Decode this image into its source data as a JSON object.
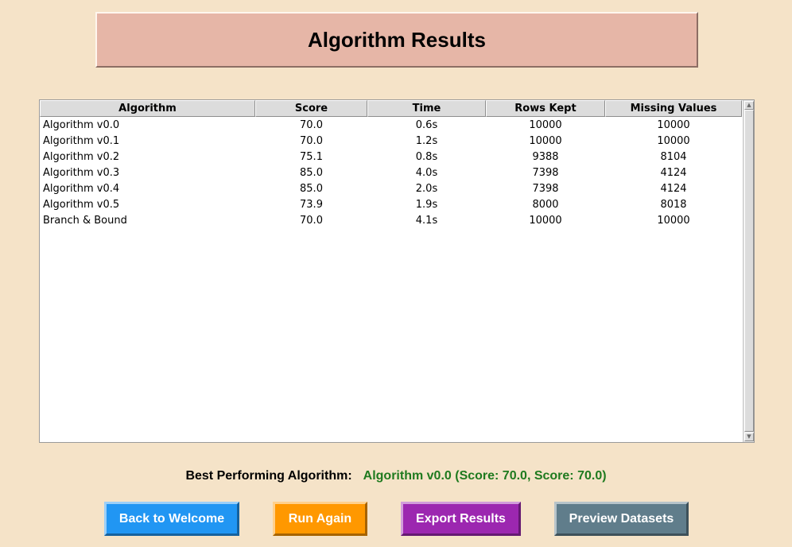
{
  "header": {
    "title": "Algorithm Results"
  },
  "table": {
    "columns": [
      "Algorithm",
      "Score",
      "Time",
      "Rows Kept",
      "Missing Values"
    ],
    "rows": [
      [
        "Algorithm v0.0",
        "70.0",
        "0.6s",
        "10000",
        "10000"
      ],
      [
        "Algorithm v0.1",
        "70.0",
        "1.2s",
        "10000",
        "10000"
      ],
      [
        "Algorithm v0.2",
        "75.1",
        "0.8s",
        "9388",
        "8104"
      ],
      [
        "Algorithm v0.3",
        "85.0",
        "4.0s",
        "7398",
        "4124"
      ],
      [
        "Algorithm v0.4",
        "85.0",
        "2.0s",
        "7398",
        "4124"
      ],
      [
        "Algorithm v0.5",
        "73.9",
        "1.9s",
        "8000",
        "8018"
      ],
      [
        "Branch & Bound",
        "70.0",
        "4.1s",
        "10000",
        "10000"
      ]
    ]
  },
  "best": {
    "label": "Best Performing Algorithm:",
    "value": "Algorithm v0.0 (Score: 70.0, Score: 70.0)",
    "value_color": "#1f7a1f"
  },
  "buttons": {
    "back": {
      "label": "Back to Welcome",
      "color": "#2196f3"
    },
    "run": {
      "label": "Run Again",
      "color": "#ff9800"
    },
    "export": {
      "label": "Export Results",
      "color": "#9c27b0"
    },
    "preview": {
      "label": "Preview Datasets",
      "color": "#607d8b"
    }
  },
  "colors": {
    "background": "#f5e3c8",
    "header_bg": "#e6b6a7"
  }
}
